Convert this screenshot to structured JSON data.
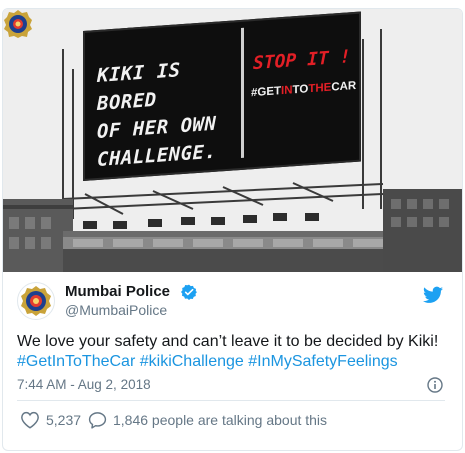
{
  "billboard": {
    "left_lines": [
      "KIKI IS BORED",
      "OF HER OWN",
      "CHALLENGE."
    ],
    "stop": "STOP IT !",
    "tag_prefix": "#GET",
    "tag_in": "IN",
    "tag_to": "TO",
    "tag_the": "THE",
    "tag_car": "CAR"
  },
  "tweet": {
    "name": "Mumbai Police",
    "handle": "@MumbaiPolice",
    "text": "We love your safety and can’t leave it to be decided by Kiki!",
    "hashtags": [
      "#GetInToTheCar",
      "#kikiChallenge",
      "#InMySafetyFeelings"
    ],
    "timestamp": "7:44 AM - Aug 2, 2018",
    "likes": "5,237",
    "talking": "1,846 people are talking about this"
  },
  "colors": {
    "link": "#1b95e0",
    "verified": "#1da1f2",
    "billboard_red": "#e21f26",
    "muted": "#657786"
  },
  "icons": [
    "police-emblem-icon",
    "verified-badge-icon",
    "twitter-bird-icon",
    "info-icon",
    "heart-icon",
    "reply-bubble-icon"
  ]
}
